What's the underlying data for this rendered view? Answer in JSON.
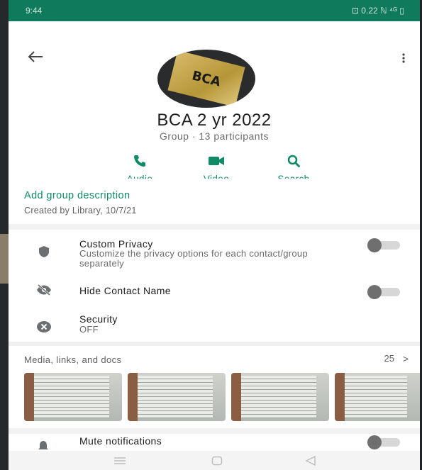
{
  "status_bar": {
    "time": "9:44",
    "indicators": "⊡ 0.22 ℕ ⁴ᴳ ▯"
  },
  "header": {
    "back_icon": "arrow-left-icon",
    "more_icon": "more-vertical-icon",
    "avatar_logo_text": "BCA",
    "group_name": "BCA 2 yr 2022",
    "group_subtitle": "Group · 13 participants"
  },
  "actions": [
    {
      "icon": "phone-icon",
      "label": "Audio"
    },
    {
      "icon": "video-icon",
      "label": "Video"
    },
    {
      "icon": "search-icon",
      "label": "Search"
    }
  ],
  "description": {
    "add_label": "Add group description",
    "created_by": "Created by Library, 10/7/21"
  },
  "settings": {
    "custom_privacy": {
      "label": "Custom Privacy",
      "sub": "Customize the privacy options for each contact/group separately",
      "enabled": false
    },
    "hide_contact_name": {
      "label": "Hide Contact Name",
      "enabled": false
    },
    "security": {
      "label": "Security",
      "value": "OFF"
    }
  },
  "media": {
    "header": "Media, links, and docs",
    "count": "25",
    "chevron": ">"
  },
  "mute": {
    "label": "Mute notifications",
    "enabled": false
  },
  "colors": {
    "accent": "#118a68",
    "status_bar": "#0f7a5c"
  }
}
